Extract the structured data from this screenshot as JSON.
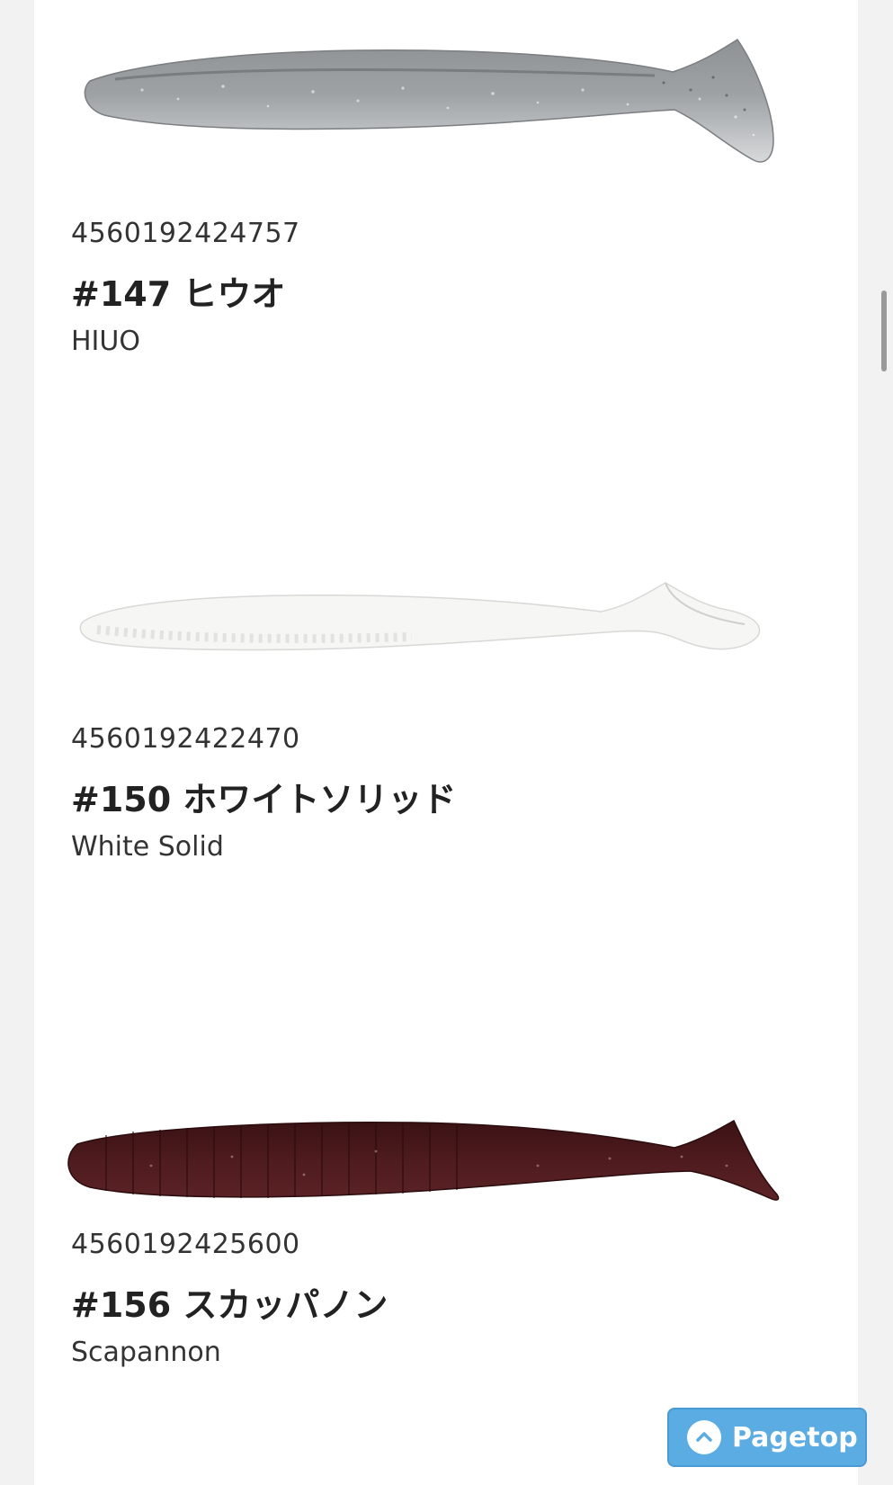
{
  "products": [
    {
      "jan": "4560192424757",
      "name": "#147 ヒウオ",
      "en": "HIUO",
      "color": "#a9adb0"
    },
    {
      "jan": "4560192422470",
      "name": "#150 ホワイトソリッド",
      "en": "White Solid",
      "color": "#f4f4f2"
    },
    {
      "jan": "4560192425600",
      "name": "#156 スカッパノン",
      "en": "Scapannon",
      "color": "#4a1a1c"
    }
  ],
  "pagetop": {
    "label": "Pagetop",
    "icon": "chevron-up-icon",
    "color": "#5aace3"
  }
}
